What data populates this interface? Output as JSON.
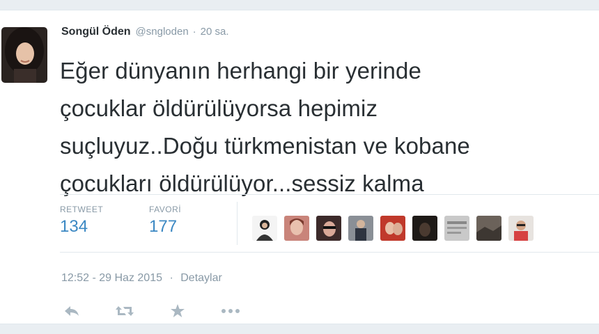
{
  "tweet": {
    "author_name": "Songül Öden",
    "handle": "@sngloden",
    "time_ago": "20 sa.",
    "text_lines": [
      "Eğer dünyanın herhangi bir yerinde",
      "çocuklar öldürülüyorsa hepimiz",
      "suçluyuz..Doğu türkmenistan ve kobane",
      "çocukları öldürülüyor...sessiz kalma"
    ],
    "stats": {
      "retweets_label": "RETWEET",
      "retweets_value": "134",
      "favorites_label": "FAVORİ",
      "favorites_value": "177"
    },
    "timestamp": "12:52 - 29 Haz 2015",
    "details_link": "Detaylar",
    "icons": {
      "reply": "reply-icon",
      "retweet": "retweet-icon",
      "favorite": "star-icon",
      "more": "more-icon"
    }
  },
  "colors": {
    "link_blue": "#3b88c3",
    "muted_gray": "#8899a6",
    "text_dark": "#292f33",
    "icon_gray": "#aab8c2"
  }
}
